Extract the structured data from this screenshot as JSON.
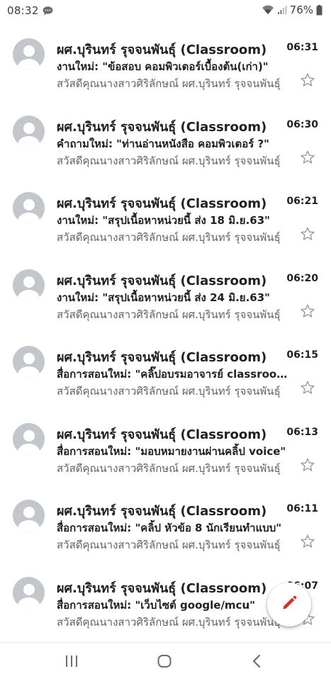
{
  "status_bar": {
    "time": "08:32",
    "battery": "76%",
    "icons": [
      "chat-bubble-icon",
      "wifi-icon",
      "signal-icon",
      "battery-icon"
    ]
  },
  "emails": [
    {
      "sender": "ผศ.บุรินทร์ รุจจนพันธุ์ (Classroom)",
      "time": "06:31",
      "subject": "งานใหม่: \"ข้อสอบ คอมพิวเตอร์เบื้องต้น(เก่า)\"",
      "snippet": "สวัสดีคุณนางสาวศิริลักษณ์ ผศ.บุรินทร์ รุจจนพันธุ์"
    },
    {
      "sender": "ผศ.บุรินทร์ รุจจนพันธุ์ (Classroom)",
      "time": "06:30",
      "subject": "คำถามใหม่: \"ท่านอ่านหนังสือ คอมพิวเตอร์ ?\"",
      "snippet": "สวัสดีคุณนางสาวศิริลักษณ์ ผศ.บุรินทร์ รุจจนพันธุ์"
    },
    {
      "sender": "ผศ.บุรินทร์ รุจจนพันธุ์ (Classroom)",
      "time": "06:21",
      "subject": "งานใหม่: \"สรุปเนื้อหาหน่วยนี้ ส่ง 18 มิ.ย.63\"",
      "snippet": "สวัสดีคุณนางสาวศิริลักษณ์ ผศ.บุรินทร์ รุจจนพันธุ์"
    },
    {
      "sender": "ผศ.บุรินทร์ รุจจนพันธุ์ (Classroom)",
      "time": "06:20",
      "subject": "งานใหม่: \"สรุปเนื้อหาหน่วยนี้ ส่ง 24 มิ.ย.63\"",
      "snippet": "สวัสดีคุณนางสาวศิริลักษณ์ ผศ.บุรินทร์ รุจจนพันธุ์"
    },
    {
      "sender": "ผศ.บุรินทร์ รุจจนพันธุ์ (Classroom)",
      "time": "06:15",
      "subject": "สื่อการสอนใหม่: \"คลิ๊ปอบรมอาจารย์ classroom\"",
      "snippet": "สวัสดีคุณนางสาวศิริลักษณ์ ผศ.บุรินทร์ รุจจนพันธุ์"
    },
    {
      "sender": "ผศ.บุรินทร์ รุจจนพันธุ์ (Classroom)",
      "time": "06:13",
      "subject": "สื่อการสอนใหม่: \"มอบหมายงานผ่านคลิ้ป voice\"",
      "snippet": "สวัสดีคุณนางสาวศิริลักษณ์ ผศ.บุรินทร์ รุจจนพันธุ์"
    },
    {
      "sender": "ผศ.บุรินทร์ รุจจนพันธุ์ (Classroom)",
      "time": "06:11",
      "subject": "สื่อการสอนใหม่: \"คลิ้ป หัวข้อ 8 นักเรียนทำแบบ\"",
      "snippet": "สวัสดีคุณนางสาวศิริลักษณ์ ผศ.บุรินทร์ รุจจนพันธุ์"
    },
    {
      "sender": "ผศ.บุรินทร์ รุจจนพันธุ์ (Classroom)",
      "time": "06:07",
      "subject": "สื่อการสอนใหม่: \"เว็บไซต์ google/mcu\"",
      "snippet": "สวัสดีคุณนางสาวศิริลักษณ์ ผศ.บุรินทร์ รุจจนพันธุ์"
    }
  ],
  "fab": {
    "icon": "pencil-icon",
    "color": "#d93025"
  },
  "nav_bar": {
    "icons": [
      "recent-apps-icon",
      "home-icon",
      "back-icon"
    ]
  },
  "colors": {
    "avatar": "#c3c6ca",
    "snippet": "#5f6368",
    "star": "#9aa0a6"
  }
}
